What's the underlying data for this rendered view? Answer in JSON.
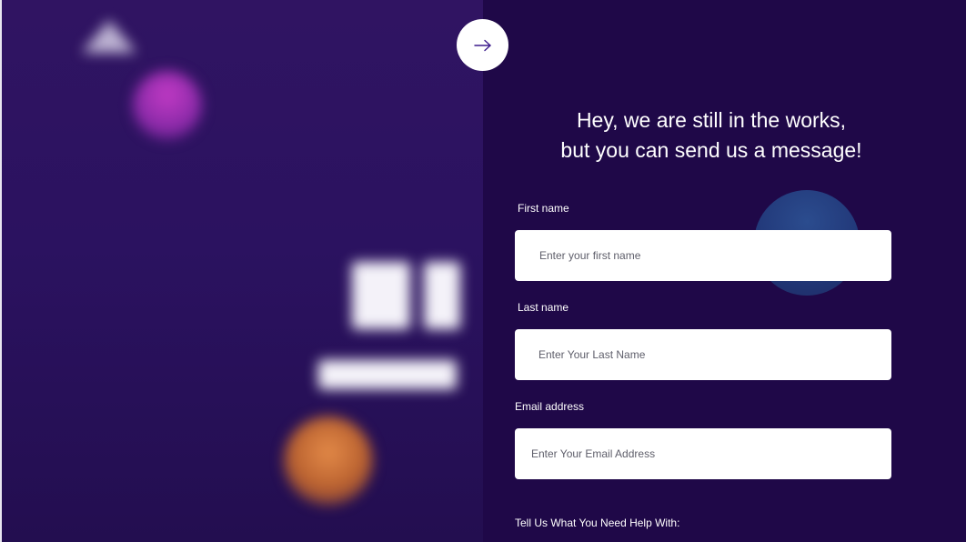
{
  "colors": {
    "left_panel_bg": "#2b1260",
    "right_panel_bg": "#1f0848",
    "accent": "#3c1a8c",
    "input_bg": "#ffffff"
  },
  "nav": {
    "next_icon": "arrow-right-icon"
  },
  "form": {
    "heading_line1": "Hey, we are still in the works,",
    "heading_line2": "but you can send us a message!",
    "first_name": {
      "label": "First name",
      "placeholder": "Enter your first name",
      "value": ""
    },
    "last_name": {
      "label": "Last name",
      "placeholder": "Enter Your Last Name",
      "value": ""
    },
    "email": {
      "label": "Email address",
      "placeholder": "Enter Your Email Address",
      "value": ""
    },
    "help_label": "Tell Us What You Need Help With:"
  }
}
